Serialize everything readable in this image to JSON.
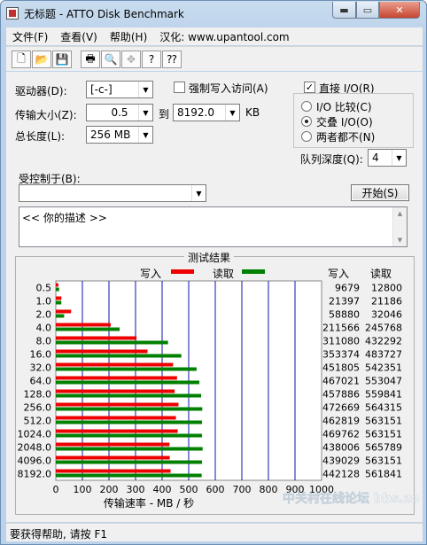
{
  "window": {
    "title": "无标题 - ATTO Disk Benchmark",
    "min_glyph": "▬",
    "max_glyph": "▭",
    "close_glyph": "✕"
  },
  "menu": [
    "文件(F)",
    "查看(V)",
    "帮助(H)",
    "汉化: www.upantool.com"
  ],
  "toolbar": [
    {
      "icon": "new-document-icon",
      "glyph": "🗋"
    },
    {
      "icon": "open-folder-icon",
      "glyph": "📂"
    },
    {
      "icon": "save-icon",
      "glyph": "💾"
    },
    {
      "icon": "print-icon",
      "glyph": "🖶"
    },
    {
      "icon": "print-preview-icon",
      "glyph": "🔍"
    },
    {
      "icon": "move-icon",
      "glyph": "✥"
    },
    {
      "icon": "help-icon",
      "glyph": "?"
    },
    {
      "icon": "context-help-icon",
      "glyph": "⁇"
    }
  ],
  "settings": {
    "drive_label": "驱动器(D):",
    "drive_value": "[-c-]",
    "force_write_label": "强制写入访问(A)",
    "force_write_checked": false,
    "direct_io_label": "直接 I/O(R)",
    "direct_io_checked": true,
    "transfer_label": "传输大小(Z):",
    "transfer_from": "0.5",
    "transfer_to_word": "到",
    "transfer_to": "8192.0",
    "transfer_unit": "KB",
    "io_options": [
      "I/O 比较(C)",
      "交叠 I/O(O)",
      "两者都不(N)"
    ],
    "io_selected": 1,
    "total_length_label": "总长度(L):",
    "total_length_value": "256 MB",
    "queue_label": "队列深度(Q):",
    "queue_value": "4",
    "controlled_by_label": "受控制于(B):",
    "controlled_by_value": "",
    "start_button": "开始(S)",
    "description": "<< 你的描述 >>",
    "check_glyph": "✓",
    "dropdown_glyph": "▼",
    "scroll_up_glyph": "▲",
    "scroll_down_glyph": "▼"
  },
  "results": {
    "title": "测试结果",
    "write_legend": "写入",
    "read_legend": "读取",
    "write_col": "写入",
    "read_col": "读取",
    "write_color": "#ee0000",
    "read_color": "#008000"
  },
  "chart_data": {
    "type": "bar",
    "categories": [
      "0.5",
      "1.0",
      "2.0",
      "4.0",
      "8.0",
      "16.0",
      "32.0",
      "64.0",
      "128.0",
      "256.0",
      "512.0",
      "1024.0",
      "2048.0",
      "4096.0",
      "8192.0"
    ],
    "series": [
      {
        "name": "写入",
        "values": [
          9679,
          21397,
          58880,
          211566,
          311080,
          353374,
          451805,
          467021,
          457886,
          472669,
          462819,
          469762,
          438006,
          439029,
          442128
        ]
      },
      {
        "name": "读取",
        "values": [
          12800,
          21186,
          32046,
          245768,
          432292,
          483727,
          542351,
          553047,
          559841,
          564315,
          563151,
          563151,
          565789,
          563151,
          561841
        ]
      }
    ],
    "xlabel": "传输速率 - MB / 秒",
    "xticks": [
      0,
      100,
      200,
      300,
      400,
      500,
      600,
      700,
      800,
      900,
      1000
    ],
    "xlim": [
      0,
      1000
    ]
  },
  "status": "要获得帮助, 请按 F1",
  "watermark": "中关村在线论坛 bbs.zol.com.cn"
}
